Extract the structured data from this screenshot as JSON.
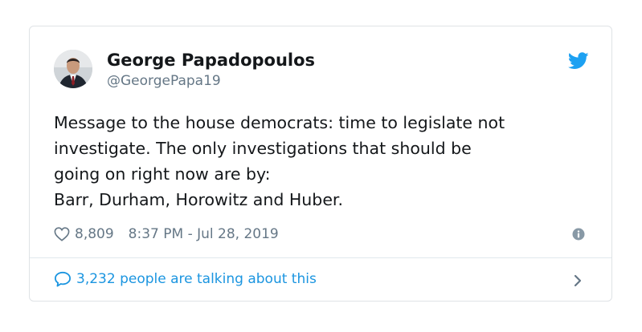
{
  "author": {
    "name": "George Papadopoulos",
    "handle": "@GeorgePapa19"
  },
  "tweet": {
    "lines": [
      "Message to the house democrats: time to legislate not",
      "investigate. The only investigations that should be",
      "going on right now are by:",
      "Barr, Durham, Horowitz and Huber."
    ]
  },
  "meta": {
    "likes": "8,809",
    "timestamp": "8:37 PM - Jul 28, 2019"
  },
  "footer": {
    "talking": "3,232 people are talking about this"
  },
  "icons": {
    "brand": "twitter-bird-icon",
    "like": "heart-icon",
    "info": "info-icon",
    "reply": "speech-bubble-icon",
    "more": "chevron-right-icon"
  },
  "colors": {
    "brand": "#1da1f2",
    "link": "#1b95e0",
    "text": "#14171a",
    "muted": "#657786",
    "border": "#e1e8ed"
  }
}
